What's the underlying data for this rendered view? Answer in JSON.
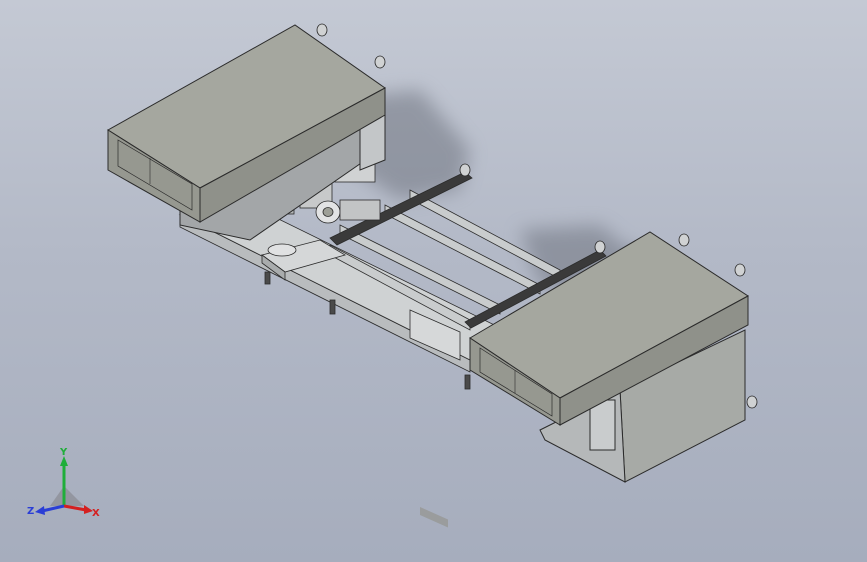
{
  "viewport": {
    "background_top": "#c4c9d4",
    "background_bottom": "#a6adbd"
  },
  "model": {
    "panel_color": "#9d9f97",
    "panel_top_color": "#a8aaa2",
    "panel_side_color": "#8d8f88",
    "frame_color": "#b9bcbe",
    "shadow_color": "#7b7f8a",
    "edge_color": "#2b2b2b"
  },
  "triad": {
    "x_label": "X",
    "y_label": "Y",
    "z_label": "Z",
    "x_color": "#d42020",
    "y_color": "#1fae3a",
    "z_color": "#2a3ed6"
  }
}
